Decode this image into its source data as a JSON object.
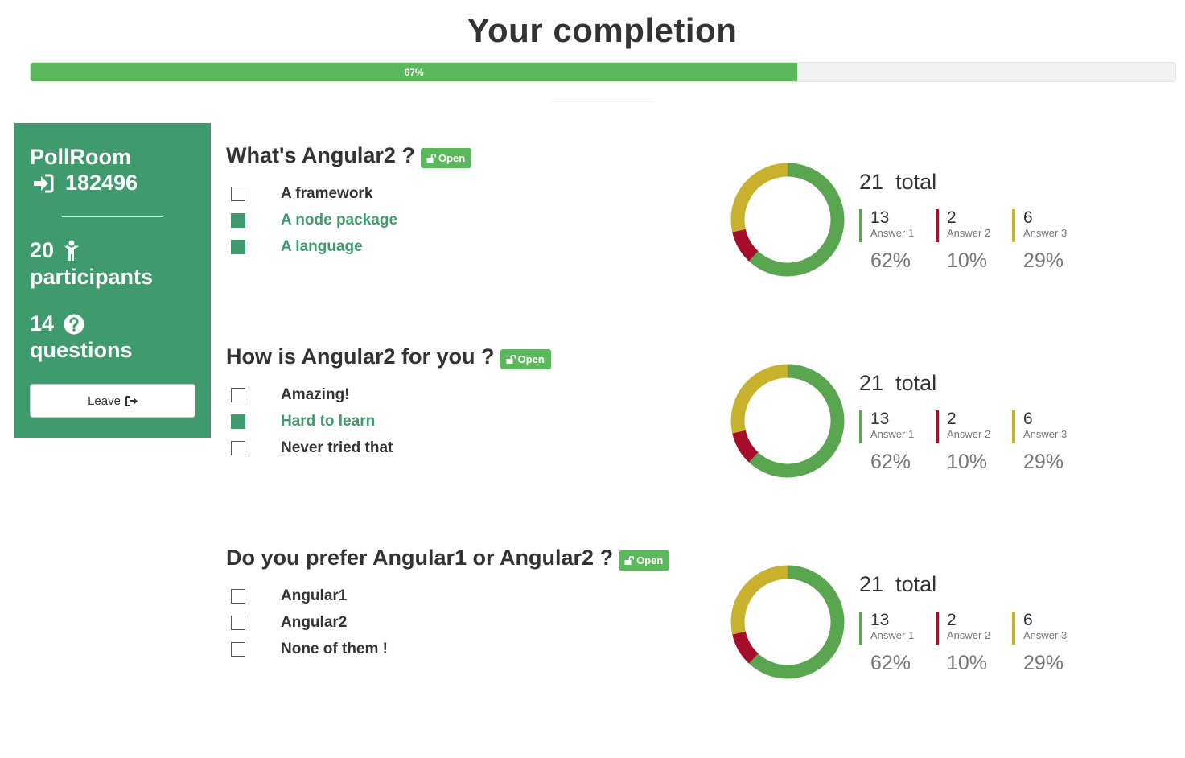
{
  "page": {
    "title": "Your completion"
  },
  "progress": {
    "value": 67,
    "label": "67%"
  },
  "sidebar": {
    "room_name": "PollRoom",
    "room_code": "182496",
    "participants_count": "20",
    "participants_label": "participants",
    "questions_count": "14",
    "questions_label": "questions",
    "leave_label": "Leave"
  },
  "colors": {
    "sidebar": "#3f9a6d",
    "progress": "#5cb85c",
    "answer1": "#5aa650",
    "answer2": "#a50d2a",
    "answer3": "#c8b22d"
  },
  "questions": [
    {
      "title": "What's Angular2 ?",
      "badge": "Open",
      "options": [
        {
          "label": "A framework",
          "checked": false
        },
        {
          "label": "A node package",
          "checked": true
        },
        {
          "label": "A language",
          "checked": true
        }
      ],
      "stats": {
        "total": "21",
        "total_label": "total",
        "answers": [
          {
            "count": "13",
            "name": "Answer 1",
            "percent": "62%",
            "value": 13
          },
          {
            "count": "2",
            "name": "Answer 2",
            "percent": "10%",
            "value": 2
          },
          {
            "count": "6",
            "name": "Answer 3",
            "percent": "29%",
            "value": 6
          }
        ]
      }
    },
    {
      "title": "How is Angular2 for you ?",
      "badge": "Open",
      "options": [
        {
          "label": "Amazing!",
          "checked": false
        },
        {
          "label": "Hard to learn",
          "checked": true
        },
        {
          "label": "Never tried that",
          "checked": false
        }
      ],
      "stats": {
        "total": "21",
        "total_label": "total",
        "answers": [
          {
            "count": "13",
            "name": "Answer 1",
            "percent": "62%",
            "value": 13
          },
          {
            "count": "2",
            "name": "Answer 2",
            "percent": "10%",
            "value": 2
          },
          {
            "count": "6",
            "name": "Answer 3",
            "percent": "29%",
            "value": 6
          }
        ]
      }
    },
    {
      "title": "Do you prefer Angular1 or Angular2 ?",
      "badge": "Open",
      "options": [
        {
          "label": "Angular1",
          "checked": false
        },
        {
          "label": "Angular2",
          "checked": false
        },
        {
          "label": "None of them !",
          "checked": false
        }
      ],
      "stats": {
        "total": "21",
        "total_label": "total",
        "answers": [
          {
            "count": "13",
            "name": "Answer 1",
            "percent": "62%",
            "value": 13
          },
          {
            "count": "2",
            "name": "Answer 2",
            "percent": "10%",
            "value": 2
          },
          {
            "count": "6",
            "name": "Answer 3",
            "percent": "29%",
            "value": 6
          }
        ]
      }
    }
  ]
}
